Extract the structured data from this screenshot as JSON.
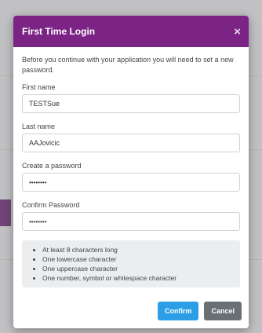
{
  "modal": {
    "title": "First Time Login",
    "close_glyph": "×",
    "intro": "Before you continue with your application you will need to set a new password."
  },
  "form": {
    "first_name": {
      "label": "First name",
      "value": "TESTSue"
    },
    "last_name": {
      "label": "Last name",
      "value": "AAJovicic"
    },
    "password": {
      "label": "Create a password",
      "value": "••••••••"
    },
    "confirm_password": {
      "label": "Confirm Password",
      "value": "••••••••"
    }
  },
  "requirements": [
    "At least 8 characters long",
    "One lowercase character",
    "One uppercase character",
    "One number, symbol or whitespace character"
  ],
  "buttons": {
    "confirm": "Confirm",
    "cancel": "Cancel"
  },
  "colors": {
    "header": "#7b2485",
    "confirm": "#2c9ee6",
    "cancel": "#6a6f76"
  }
}
